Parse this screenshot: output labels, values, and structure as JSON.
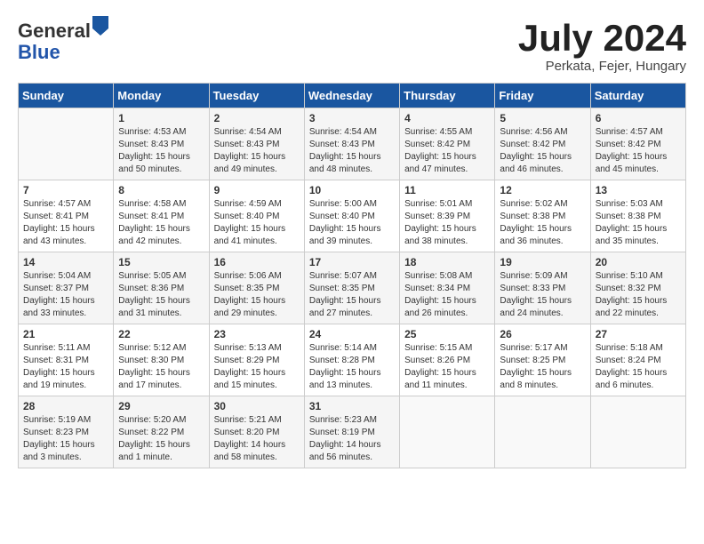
{
  "header": {
    "logo_line1": "General",
    "logo_line2": "Blue",
    "month_year": "July 2024",
    "location": "Perkata, Fejer, Hungary"
  },
  "days_of_week": [
    "Sunday",
    "Monday",
    "Tuesday",
    "Wednesday",
    "Thursday",
    "Friday",
    "Saturday"
  ],
  "weeks": [
    [
      {
        "day": "",
        "content": ""
      },
      {
        "day": "1",
        "content": "Sunrise: 4:53 AM\nSunset: 8:43 PM\nDaylight: 15 hours\nand 50 minutes."
      },
      {
        "day": "2",
        "content": "Sunrise: 4:54 AM\nSunset: 8:43 PM\nDaylight: 15 hours\nand 49 minutes."
      },
      {
        "day": "3",
        "content": "Sunrise: 4:54 AM\nSunset: 8:43 PM\nDaylight: 15 hours\nand 48 minutes."
      },
      {
        "day": "4",
        "content": "Sunrise: 4:55 AM\nSunset: 8:42 PM\nDaylight: 15 hours\nand 47 minutes."
      },
      {
        "day": "5",
        "content": "Sunrise: 4:56 AM\nSunset: 8:42 PM\nDaylight: 15 hours\nand 46 minutes."
      },
      {
        "day": "6",
        "content": "Sunrise: 4:57 AM\nSunset: 8:42 PM\nDaylight: 15 hours\nand 45 minutes."
      }
    ],
    [
      {
        "day": "7",
        "content": "Sunrise: 4:57 AM\nSunset: 8:41 PM\nDaylight: 15 hours\nand 43 minutes."
      },
      {
        "day": "8",
        "content": "Sunrise: 4:58 AM\nSunset: 8:41 PM\nDaylight: 15 hours\nand 42 minutes."
      },
      {
        "day": "9",
        "content": "Sunrise: 4:59 AM\nSunset: 8:40 PM\nDaylight: 15 hours\nand 41 minutes."
      },
      {
        "day": "10",
        "content": "Sunrise: 5:00 AM\nSunset: 8:40 PM\nDaylight: 15 hours\nand 39 minutes."
      },
      {
        "day": "11",
        "content": "Sunrise: 5:01 AM\nSunset: 8:39 PM\nDaylight: 15 hours\nand 38 minutes."
      },
      {
        "day": "12",
        "content": "Sunrise: 5:02 AM\nSunset: 8:38 PM\nDaylight: 15 hours\nand 36 minutes."
      },
      {
        "day": "13",
        "content": "Sunrise: 5:03 AM\nSunset: 8:38 PM\nDaylight: 15 hours\nand 35 minutes."
      }
    ],
    [
      {
        "day": "14",
        "content": "Sunrise: 5:04 AM\nSunset: 8:37 PM\nDaylight: 15 hours\nand 33 minutes."
      },
      {
        "day": "15",
        "content": "Sunrise: 5:05 AM\nSunset: 8:36 PM\nDaylight: 15 hours\nand 31 minutes."
      },
      {
        "day": "16",
        "content": "Sunrise: 5:06 AM\nSunset: 8:35 PM\nDaylight: 15 hours\nand 29 minutes."
      },
      {
        "day": "17",
        "content": "Sunrise: 5:07 AM\nSunset: 8:35 PM\nDaylight: 15 hours\nand 27 minutes."
      },
      {
        "day": "18",
        "content": "Sunrise: 5:08 AM\nSunset: 8:34 PM\nDaylight: 15 hours\nand 26 minutes."
      },
      {
        "day": "19",
        "content": "Sunrise: 5:09 AM\nSunset: 8:33 PM\nDaylight: 15 hours\nand 24 minutes."
      },
      {
        "day": "20",
        "content": "Sunrise: 5:10 AM\nSunset: 8:32 PM\nDaylight: 15 hours\nand 22 minutes."
      }
    ],
    [
      {
        "day": "21",
        "content": "Sunrise: 5:11 AM\nSunset: 8:31 PM\nDaylight: 15 hours\nand 19 minutes."
      },
      {
        "day": "22",
        "content": "Sunrise: 5:12 AM\nSunset: 8:30 PM\nDaylight: 15 hours\nand 17 minutes."
      },
      {
        "day": "23",
        "content": "Sunrise: 5:13 AM\nSunset: 8:29 PM\nDaylight: 15 hours\nand 15 minutes."
      },
      {
        "day": "24",
        "content": "Sunrise: 5:14 AM\nSunset: 8:28 PM\nDaylight: 15 hours\nand 13 minutes."
      },
      {
        "day": "25",
        "content": "Sunrise: 5:15 AM\nSunset: 8:26 PM\nDaylight: 15 hours\nand 11 minutes."
      },
      {
        "day": "26",
        "content": "Sunrise: 5:17 AM\nSunset: 8:25 PM\nDaylight: 15 hours\nand 8 minutes."
      },
      {
        "day": "27",
        "content": "Sunrise: 5:18 AM\nSunset: 8:24 PM\nDaylight: 15 hours\nand 6 minutes."
      }
    ],
    [
      {
        "day": "28",
        "content": "Sunrise: 5:19 AM\nSunset: 8:23 PM\nDaylight: 15 hours\nand 3 minutes."
      },
      {
        "day": "29",
        "content": "Sunrise: 5:20 AM\nSunset: 8:22 PM\nDaylight: 15 hours\nand 1 minute."
      },
      {
        "day": "30",
        "content": "Sunrise: 5:21 AM\nSunset: 8:20 PM\nDaylight: 14 hours\nand 58 minutes."
      },
      {
        "day": "31",
        "content": "Sunrise: 5:23 AM\nSunset: 8:19 PM\nDaylight: 14 hours\nand 56 minutes."
      },
      {
        "day": "",
        "content": ""
      },
      {
        "day": "",
        "content": ""
      },
      {
        "day": "",
        "content": ""
      }
    ]
  ]
}
